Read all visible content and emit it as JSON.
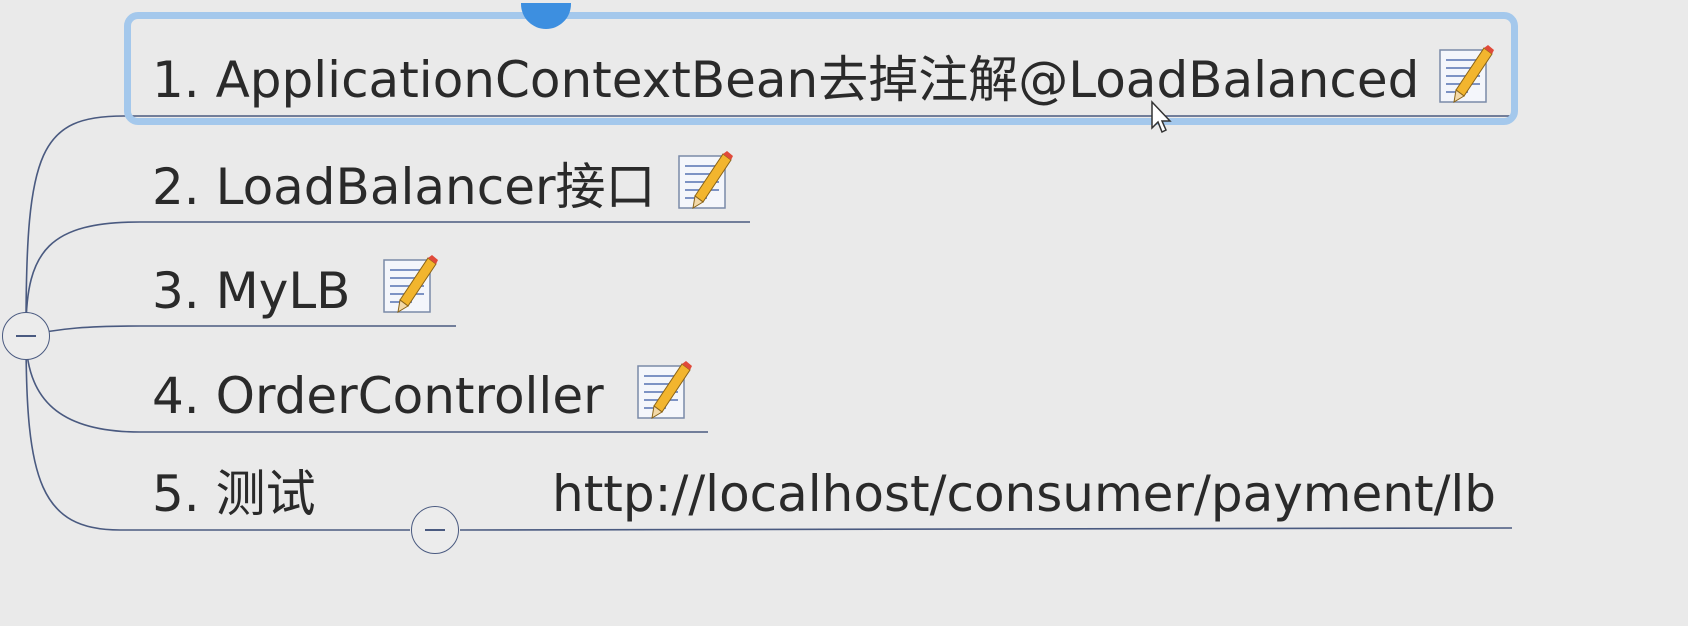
{
  "mindmap": {
    "topics": [
      {
        "label": "1. ApplicationContextBean去掉注解@LoadBalanced",
        "selected": true,
        "has_note": true
      },
      {
        "label": "2. LoadBalancer接口",
        "has_note": true
      },
      {
        "label": "3. MyLB",
        "has_note": true
      },
      {
        "label": "4. OrderController",
        "has_note": true
      },
      {
        "label": "5. 测试",
        "has_note": false,
        "subtopics": [
          {
            "label": "http://localhost/consumer/payment/lb"
          }
        ]
      }
    ],
    "icons": {
      "note": "note-pencil-icon",
      "collapse": "collapse-minus-icon",
      "selection_handle": "add-topic-handle-icon",
      "cursor": "mouse-pointer-icon"
    },
    "colors": {
      "background": "#eaeaea",
      "connector": "#4a5a80",
      "selection": "#a4c8ec",
      "selection_handle": "#3d8fe0"
    }
  }
}
